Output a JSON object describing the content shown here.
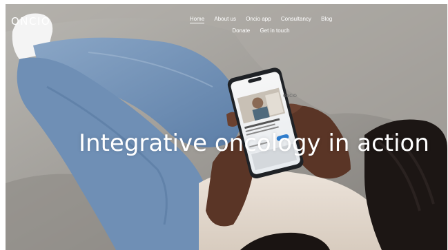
{
  "brand": {
    "logo_text": "ONCIO"
  },
  "nav": {
    "items": [
      {
        "label": "Home",
        "active": true
      },
      {
        "label": "About us",
        "active": false
      },
      {
        "label": "Oncio app",
        "active": false
      },
      {
        "label": "Consultancy",
        "active": false
      },
      {
        "label": "Blog",
        "active": false
      },
      {
        "label": "Donate",
        "active": false
      },
      {
        "label": "Get in touch",
        "active": false
      }
    ]
  },
  "hero": {
    "title": "Integrative oncology in action",
    "phone_app_name": "ONCIO"
  },
  "colors": {
    "text": "#ffffff",
    "sofa": "#a8a5a0",
    "jeans": "#6f8fb5",
    "skin": "#5a3526",
    "phone_frame": "#1f2226",
    "app_accent": "#2f7fd0"
  }
}
